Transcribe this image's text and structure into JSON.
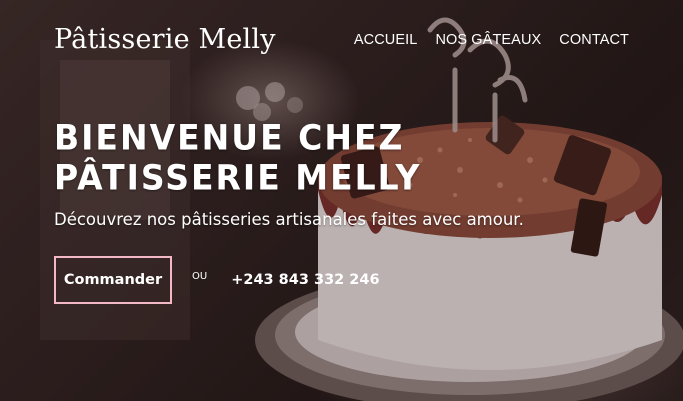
{
  "header": {
    "logo": "Pâtisserie Melly",
    "nav": [
      "ACCUEIL",
      "NOS GÂTEAUX",
      "CONTACT"
    ]
  },
  "hero": {
    "title": "BIENVENUE CHEZ PÂTISSERIE MELLY",
    "tagline": "Découvrez nos pâtisseries artisanales faites avec amour.",
    "order_button": "Commander",
    "or_label": "OU",
    "phone": "+243 843 332 246",
    "background_image": "cake-photo"
  },
  "colors": {
    "accent_border": "#f2b8c6",
    "text": "#ffffff"
  }
}
